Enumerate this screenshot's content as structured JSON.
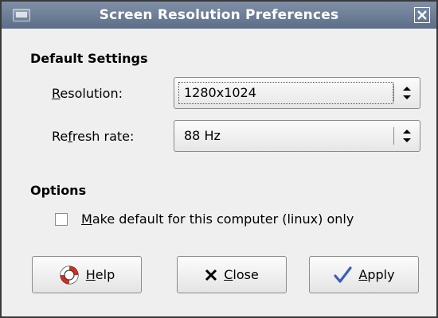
{
  "window": {
    "title": "Screen Resolution Preferences",
    "icons": {
      "app": "monitor-icon",
      "close": "close-icon"
    }
  },
  "default_settings": {
    "heading": "Default Settings",
    "resolution": {
      "label_mnemonic": "R",
      "label_rest": "esolution:",
      "value": "1280x1024"
    },
    "refresh_rate": {
      "label_pre": "Re",
      "label_mnemonic": "f",
      "label_rest": "resh rate:",
      "value": "88 Hz"
    }
  },
  "options": {
    "heading": "Options",
    "make_default": {
      "mnemonic": "M",
      "rest": "ake default for this computer (linux) only",
      "checked": false
    }
  },
  "buttons": {
    "help": {
      "mnemonic": "H",
      "rest": "elp",
      "icon": "lifebuoy-icon"
    },
    "close": {
      "mnemonic": "C",
      "rest": "lose",
      "icon": "x-icon"
    },
    "apply": {
      "mnemonic": "A",
      "rest": "pply",
      "icon": "checkmark-icon"
    }
  },
  "colors": {
    "titlebar": "#6f7f99",
    "dialog_bg": "#efefef",
    "help_icon_red": "#d42d1f",
    "apply_check_blue": "#3a5fb4"
  }
}
